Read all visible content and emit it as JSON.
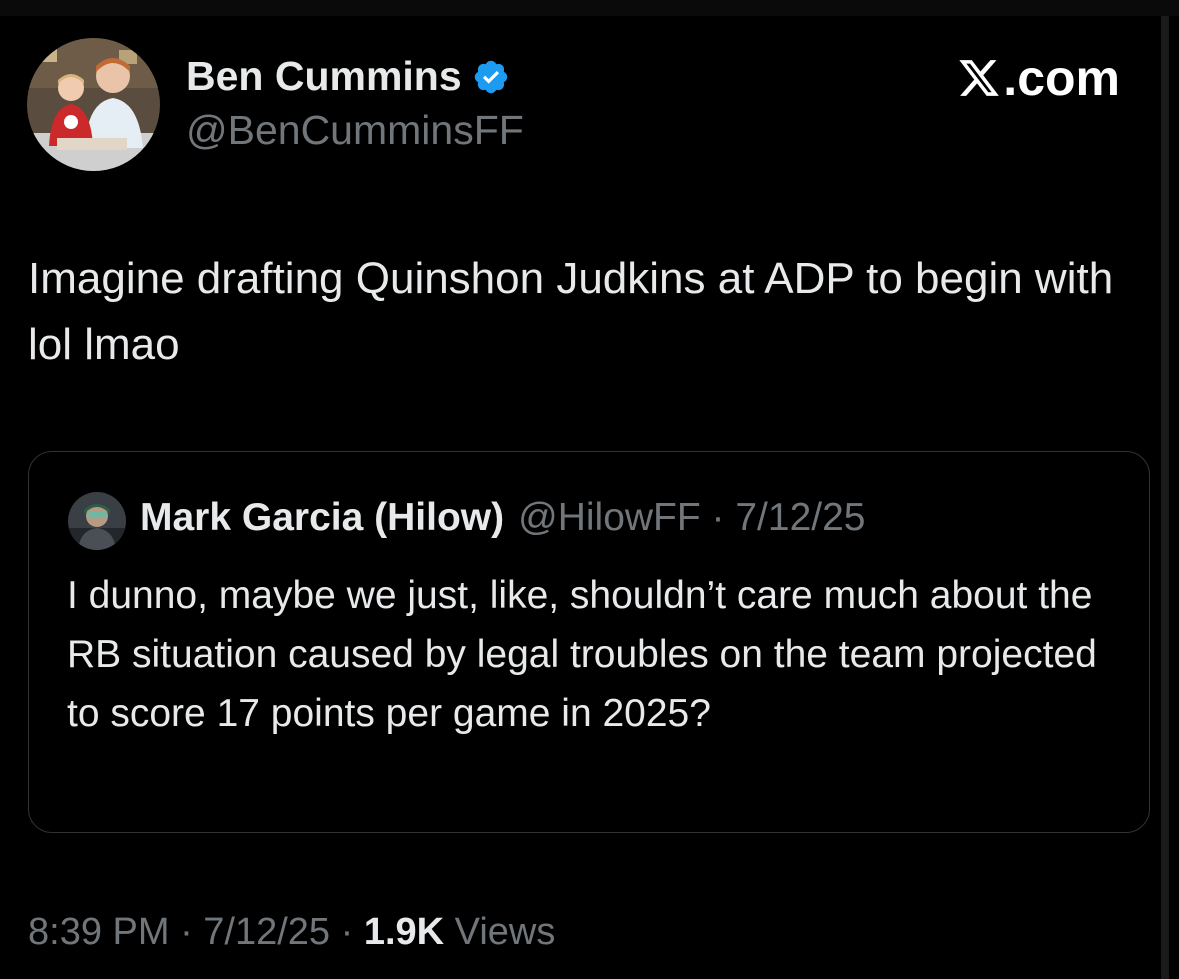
{
  "author": {
    "name": "Ben Cummins",
    "handle": "@BenCumminsFF",
    "verified_icon": "verified-badge-icon",
    "verified_color": "#1d9bf0"
  },
  "brand": {
    "text": ".com",
    "icon": "x-logo-icon"
  },
  "tweet": {
    "text": "Imagine drafting Quinshon Judkins at ADP to begin with lol lmao"
  },
  "quote": {
    "author_name": "Mark Garcia (Hilow)",
    "meta": "@HilowFF · 7/12/25",
    "text": "I dunno, maybe we just, like, shouldn’t care much about the RB situation caused by legal troubles on the team projected to score 17 points per game in 2025?"
  },
  "footer": {
    "time": "8:39 PM · 7/12/25 · ",
    "views_count": "1.9K",
    "views_label": " Views"
  },
  "colors": {
    "background": "#000000",
    "text_primary": "#e7e9ea",
    "text_secondary": "#71767b",
    "border": "#2f3336"
  }
}
